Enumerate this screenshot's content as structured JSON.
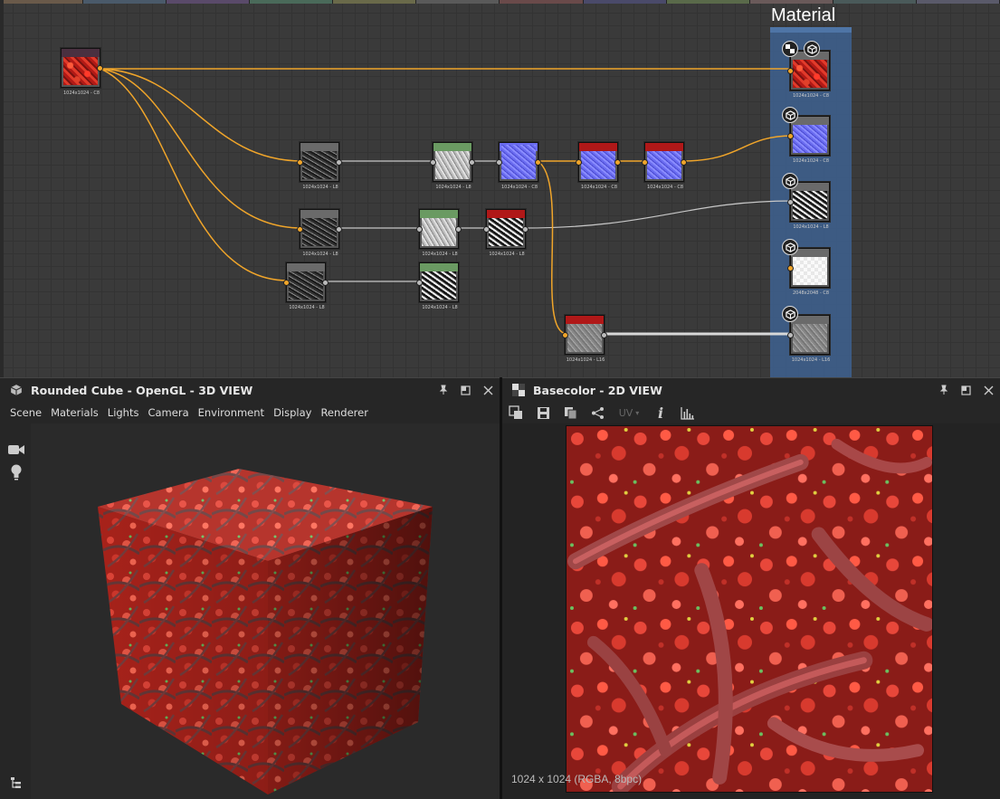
{
  "graph": {
    "frame_title": "Material",
    "nodes": [
      {
        "id": "n1",
        "caption": "1024x1024 - C8"
      },
      {
        "id": "n2",
        "caption": "1024x1024 - L8"
      },
      {
        "id": "n3",
        "caption": "1024x1024 - L8"
      },
      {
        "id": "n4",
        "caption": "1024x1024 - C8"
      },
      {
        "id": "n5",
        "caption": "1024x1024 - C8"
      },
      {
        "id": "n6",
        "caption": "1024x1024 - C8"
      },
      {
        "id": "n7",
        "caption": "1024x1024 - L8"
      },
      {
        "id": "n8",
        "caption": "1024x1024 - L8"
      },
      {
        "id": "n9",
        "caption": "1024x1024 - L8"
      },
      {
        "id": "n10",
        "caption": "1024x1024 - L8"
      },
      {
        "id": "n11",
        "caption": "1024x1024 - L8"
      },
      {
        "id": "n12",
        "caption": "1024x1024 - L16"
      },
      {
        "id": "o1",
        "caption": "1024x1024 - C8"
      },
      {
        "id": "o2",
        "caption": "1024x1024 - C8"
      },
      {
        "id": "o3",
        "caption": "1024x1024 - L8"
      },
      {
        "id": "o4",
        "caption": "2048x2048 - C8"
      },
      {
        "id": "o5",
        "caption": "1024x1024 - L16"
      }
    ],
    "badge_icons": [
      "checker-icon",
      "cube-icon"
    ]
  },
  "view3d": {
    "title": "Rounded Cube - OpenGL - 3D VIEW",
    "menu": [
      "Scene",
      "Materials",
      "Lights",
      "Camera",
      "Environment",
      "Display",
      "Renderer"
    ]
  },
  "view2d": {
    "title": "Basecolor - 2D VIEW",
    "uv_label": "UV",
    "info_label": "i",
    "status": "1024 x 1024 (RGBA, 8bpc)"
  },
  "colors": {
    "wire_orange": "#f0a52a",
    "wire_gray": "#c8c8c8",
    "frame_blue": "#3e6496",
    "header_red": "#b01818",
    "header_green": "#6a9a62"
  }
}
